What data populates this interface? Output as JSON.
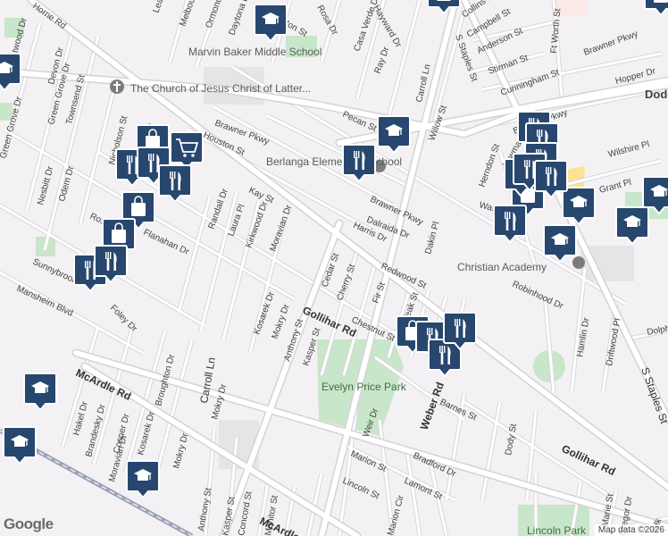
{
  "map": {
    "streets": [
      "Horne Rd",
      "Lea Ln",
      "Melbourne",
      "Ormond",
      "Daytona Dr",
      "Norton St",
      "Rosa Dr",
      "Casa Verde Dr",
      "Hayward Dr",
      "Carroll Ln",
      "S Staples St",
      "Collins St",
      "Campbell St",
      "Anderson St",
      "Stirman St",
      "Ft Worth St",
      "Cunningham St",
      "Brawner Pkwy",
      "Hopper Dr",
      "Dodd",
      "Ray Dr",
      "Brentwood Dr",
      "Devon Dr",
      "Green Grove Dr",
      "Townsend St",
      "Pecan St",
      "Houston St",
      "Nicholson St",
      "Willow St",
      "Kay St",
      "Dalraida Dr",
      "Harris Dr",
      "Randall Dr",
      "Laura Pl",
      "Kirkwood Dr",
      "Moravian Dr",
      "Ross St",
      "Flanahan Dr",
      "Nesbitt Dr",
      "Odem Dr",
      "Dakin Pl",
      "Herndon St",
      "Lowman St",
      "Wasserman",
      "Wilshire Pl",
      "Grant Pl",
      "Redwood St",
      "Robinhood Dr",
      "Cedar St",
      "Cherry St",
      "Fir St",
      "Teak St",
      "Chestnut St",
      "Sunnybrook",
      "Mansheim Blvd",
      "Foley Dr",
      "Kosarek Dr",
      "Mokry Dr",
      "Anthony St",
      "Kasper St",
      "Gollihar Rd",
      "Dody St",
      "Hamlin Dr",
      "Driftwood Pl",
      "Dolphin",
      "McArdle Rd",
      "Hakel Dr",
      "Brandesky Dr",
      "Cosner Dr",
      "Broughton Dr",
      "Weber Rd",
      "Barnes St",
      "Weir Dr",
      "Marion St",
      "Bradford Dr",
      "Lamont St",
      "Lincoln St",
      "Concord St",
      "Monitor St",
      "Marion Cir",
      "Marie St",
      "Gregor Dr",
      "Adk"
    ],
    "pois": {
      "marvin_baker": "Marvin Baker Middle School",
      "church": "The Church of Jesus Christ of Latter...",
      "berlanga": "Berlanga Elementary School",
      "christian_academy": "Christian Academy",
      "park_evelyn": "Evelyn Price Park",
      "park_lincoln": "Lincoln Park"
    },
    "pins": [
      {
        "icon": "school-icon",
        "kind": "school"
      },
      {
        "icon": "school-icon",
        "kind": "school"
      },
      {
        "icon": "school-icon",
        "kind": "school"
      },
      {
        "icon": "school-icon",
        "kind": "school"
      },
      {
        "icon": "school-icon",
        "kind": "school"
      },
      {
        "icon": "school-icon",
        "kind": "school"
      },
      {
        "icon": "school-icon",
        "kind": "school"
      },
      {
        "icon": "school-icon",
        "kind": "school"
      },
      {
        "icon": "school-icon",
        "kind": "school"
      },
      {
        "icon": "school-icon",
        "kind": "school"
      },
      {
        "icon": "shopping-bag-icon",
        "kind": "shopping"
      },
      {
        "icon": "shopping-bag-icon",
        "kind": "shopping"
      },
      {
        "icon": "shopping-bag-icon",
        "kind": "shopping"
      },
      {
        "icon": "shopping-bag-icon",
        "kind": "shopping"
      },
      {
        "icon": "shopping-bag-icon",
        "kind": "shopping"
      },
      {
        "icon": "shopping-bag-icon",
        "kind": "shopping"
      },
      {
        "icon": "shopping-bag-icon",
        "kind": "shopping"
      },
      {
        "icon": "shopping-bag-icon",
        "kind": "shopping"
      },
      {
        "icon": "shopping-cart-icon",
        "kind": "grocery"
      },
      {
        "icon": "restaurant-icon",
        "kind": "restaurant"
      },
      {
        "icon": "restaurant-icon",
        "kind": "restaurant"
      },
      {
        "icon": "restaurant-icon",
        "kind": "restaurant"
      },
      {
        "icon": "restaurant-icon",
        "kind": "restaurant"
      },
      {
        "icon": "restaurant-icon",
        "kind": "restaurant"
      },
      {
        "icon": "restaurant-icon",
        "kind": "restaurant"
      },
      {
        "icon": "restaurant-icon",
        "kind": "restaurant"
      },
      {
        "icon": "restaurant-icon",
        "kind": "restaurant"
      },
      {
        "icon": "restaurant-icon",
        "kind": "restaurant"
      },
      {
        "icon": "restaurant-icon",
        "kind": "restaurant"
      },
      {
        "icon": "restaurant-icon",
        "kind": "restaurant"
      },
      {
        "icon": "restaurant-icon",
        "kind": "restaurant"
      },
      {
        "icon": "restaurant-icon",
        "kind": "restaurant"
      },
      {
        "icon": "restaurant-icon",
        "kind": "restaurant"
      },
      {
        "icon": "restaurant-icon",
        "kind": "restaurant"
      }
    ],
    "colors": {
      "pin_fill": "#27476e",
      "land": "#f3f1f3",
      "park": "#c8e6c9",
      "road": "#ffffff",
      "road_outline": "#d9d6dc",
      "rail": "#9aa3b5",
      "highlight_block": "#fde293",
      "school_grounds": "#e9e7ea"
    }
  },
  "footer": {
    "logo": "Google",
    "attribution": "Map data ©2026"
  }
}
